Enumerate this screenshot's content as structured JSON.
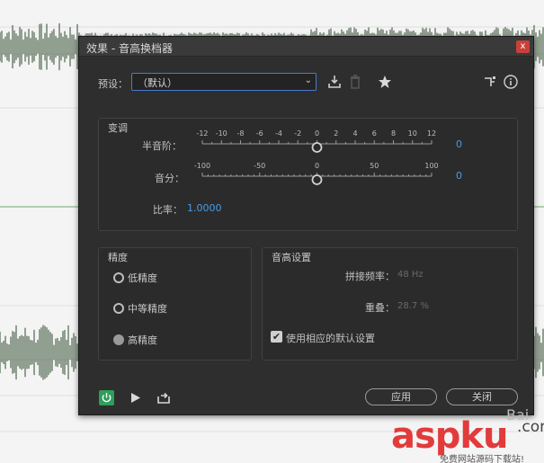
{
  "dialog": {
    "title": "效果 - 音高换档器",
    "close_glyph": "x"
  },
  "preset": {
    "label": "预设：",
    "value": "（默认）"
  },
  "transpose": {
    "title": "变调",
    "semitone_label": "半音阶：",
    "semitone_ticks": [
      "-12",
      "-10",
      "-8",
      "-6",
      "-4",
      "-2",
      "0",
      "2",
      "4",
      "6",
      "8",
      "10",
      "12"
    ],
    "semitone_value": "0",
    "cents_label": "音分：",
    "cents_ticks": [
      "-100",
      "-50",
      "0",
      "50",
      "100"
    ],
    "cents_value": "0",
    "ratio_label": "比率：",
    "ratio_value": "1.0000"
  },
  "precision": {
    "title": "精度",
    "options": [
      {
        "label": "低精度",
        "selected": false
      },
      {
        "label": "中等精度",
        "selected": false
      },
      {
        "label": "高精度",
        "selected": true
      }
    ]
  },
  "pitch_settings": {
    "title": "音高设置",
    "splice_label": "拼接频率：",
    "splice_value": "48 Hz",
    "overlap_label": "重叠：",
    "overlap_value": "28.7 %",
    "default_checkbox_label": "使用相应的默认设置",
    "default_checkbox_checked": true
  },
  "footer": {
    "apply_label": "应用",
    "close_label": "关闭"
  },
  "watermark": {
    "brand": "aspku",
    "tld": ".com",
    "sub": "免费网站源码下载站!",
    "bai": "Bai"
  },
  "colors": {
    "accent_blue": "#4a9be8",
    "power_green": "#2e9e5a",
    "arrow_red": "#e23b3b"
  }
}
